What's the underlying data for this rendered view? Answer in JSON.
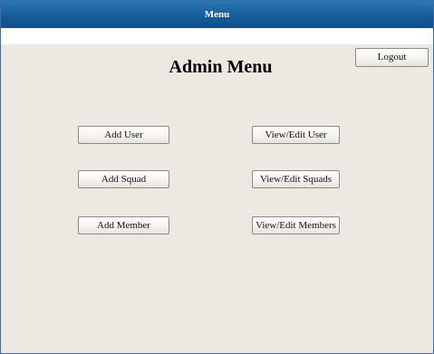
{
  "window": {
    "title": "Menu"
  },
  "main": {
    "heading": "Admin Menu",
    "logout_label": "Logout",
    "buttons": {
      "add_user": "Add User",
      "add_squad": "Add Squad",
      "add_member": "Add Member",
      "view_edit_user": "View/Edit User",
      "view_edit_squads": "View/Edit Squads",
      "view_edit_members": "View/Edit Members"
    }
  },
  "colors": {
    "titlebar": "#1a5f9e",
    "background": "#ece9e3"
  }
}
